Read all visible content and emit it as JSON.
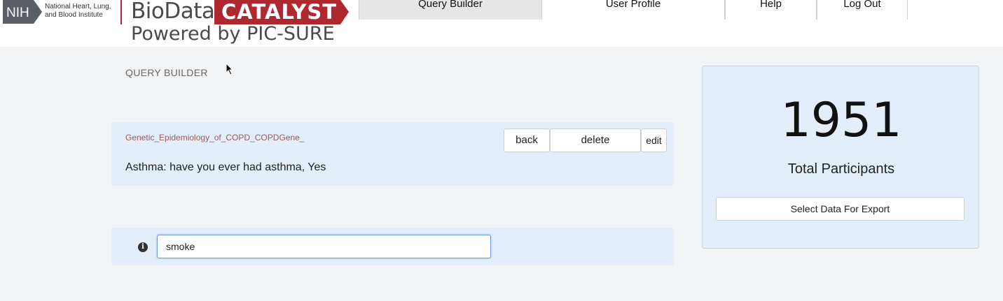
{
  "header": {
    "nih_abbrev": "NIH",
    "nih_institute": "National Heart, Lung, and Blood Institute",
    "brand_part1": "BioData",
    "brand_part2": "CATALYST",
    "brand_tagline": "Powered by PIC-SURE",
    "nav": [
      {
        "label": "Query Builder",
        "active": true
      },
      {
        "label": "User Profile",
        "active": false
      },
      {
        "label": "Help",
        "active": false
      },
      {
        "label": "Log Out",
        "active": false
      }
    ]
  },
  "main": {
    "section_title": "QUERY BUILDER",
    "query": {
      "study": "Genetic_Epidemiology_of_COPD_COPDGene_",
      "variable": "Asthma: have you ever had asthma, Yes",
      "back_label": "back",
      "delete_label": "delete",
      "edit_label": "edit"
    },
    "search": {
      "value": "smoke",
      "info_icon": "info-icon"
    }
  },
  "summary": {
    "count": "1951",
    "count_label": "Total Participants",
    "export_label": "Select Data For Export"
  },
  "colors": {
    "brand_red": "#b0282f",
    "panel_blue": "#e4edfa",
    "nih_gray": "#5a5f66",
    "study_text": "#9a5a5a"
  }
}
